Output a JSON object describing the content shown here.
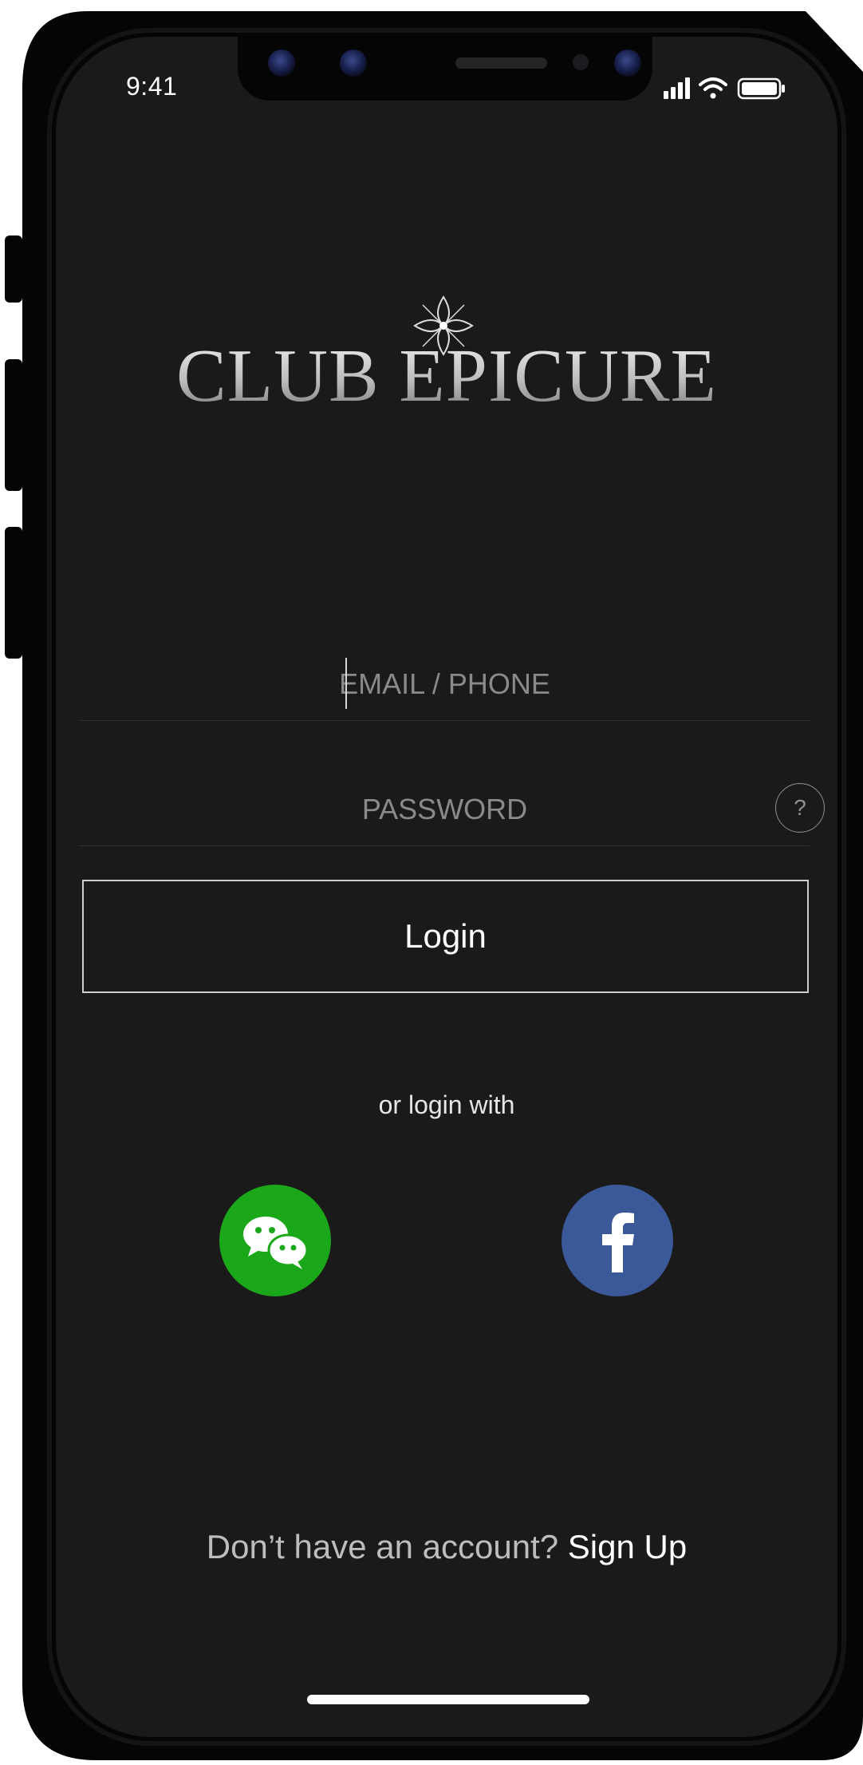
{
  "status_bar": {
    "time": "9:41"
  },
  "brand": {
    "name": "CLUB EPICURE"
  },
  "form": {
    "email_placeholder": "EMAIL / PHONE",
    "password_placeholder": "PASSWORD",
    "help_symbol": "?",
    "login_label": "Login"
  },
  "social": {
    "prompt": "or login with",
    "providers": [
      {
        "name": "WeChat",
        "icon": "wechat-icon",
        "color": "#1aa81a"
      },
      {
        "name": "Facebook",
        "icon": "facebook-icon",
        "color": "#3b5998"
      }
    ]
  },
  "footer": {
    "prompt": "Don’t have an account?",
    "signup_label": "Sign Up"
  },
  "colors": {
    "background": "#1a1a1a",
    "bezel": "#050505",
    "text_primary": "#ffffff",
    "text_muted": "#8a8a8a"
  }
}
